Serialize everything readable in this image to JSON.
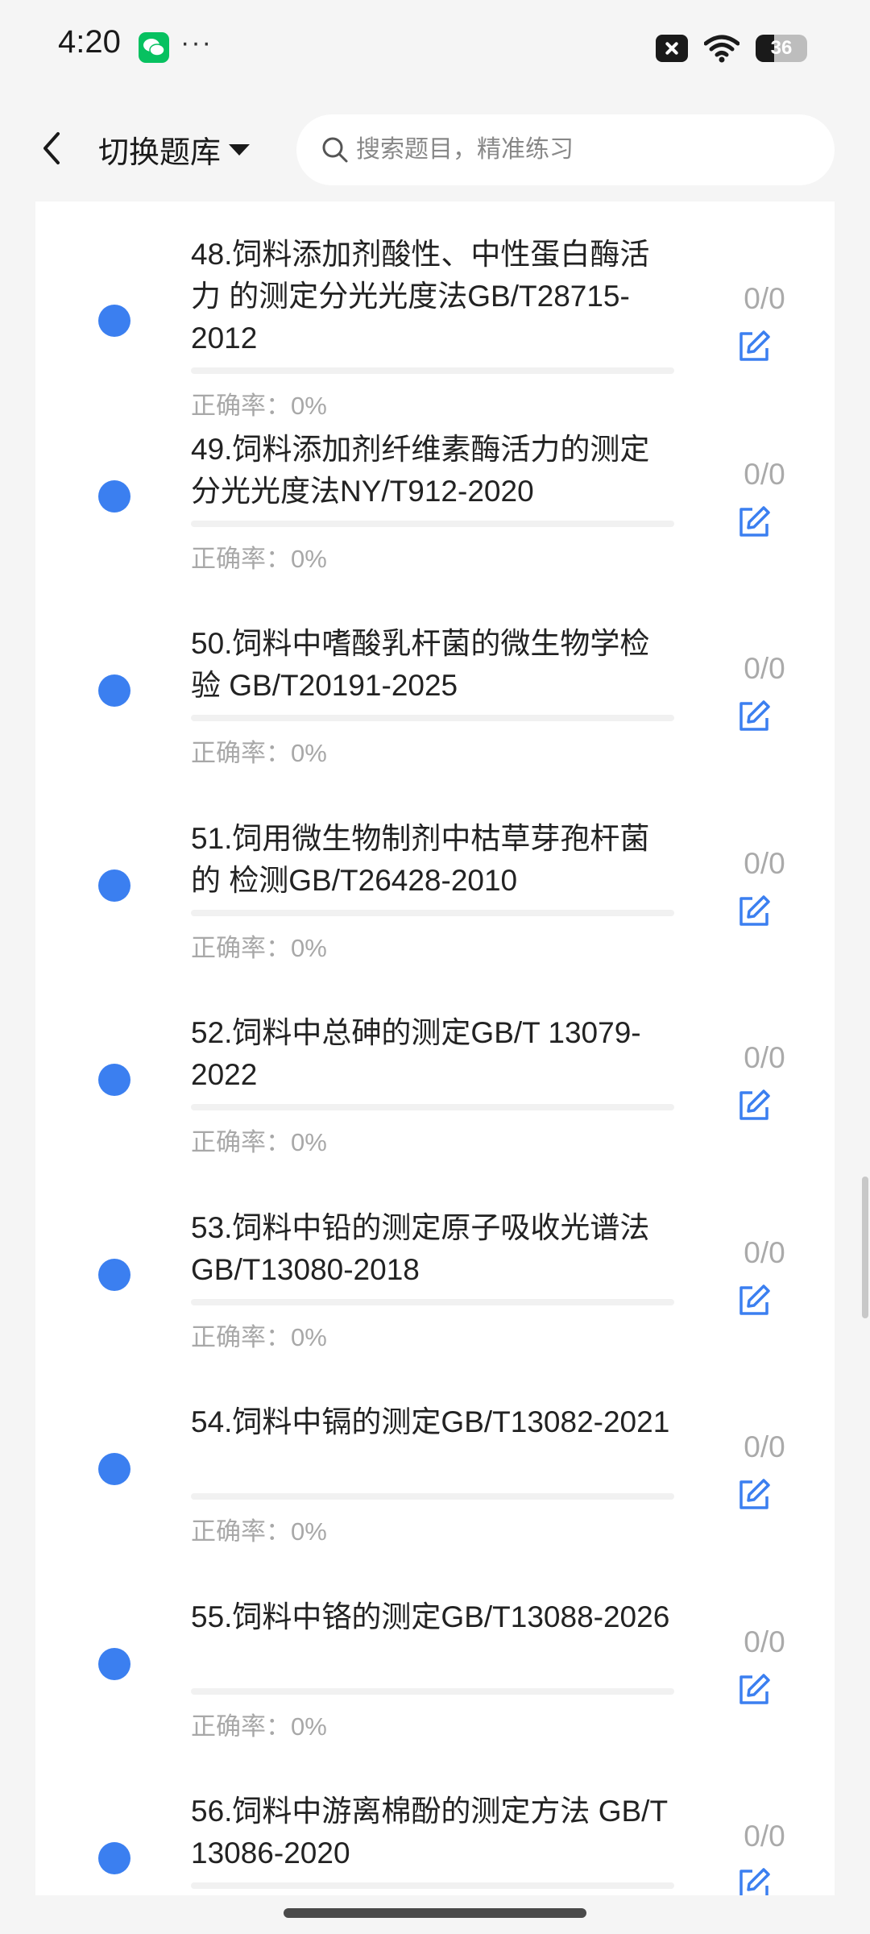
{
  "status_bar": {
    "time": "4:20",
    "dots": "···",
    "battery": "36",
    "icons": [
      "wechat-icon",
      "close-notification-icon",
      "wifi-icon",
      "battery-icon"
    ]
  },
  "header": {
    "title": "切换题库",
    "search_placeholder": "搜索题目，精准练习",
    "icons": [
      "back-icon",
      "caret-down-icon",
      "search-icon"
    ]
  },
  "accent_color": "#3b7ff0",
  "items": [
    {
      "title": "48.饲料添加剂酸性、中性蛋白酶活力 的测定分光光度法GB/T28715-2012",
      "accuracy": "正确率：0%",
      "score": "0/0",
      "progress": 0
    },
    {
      "title": "49.饲料添加剂纤维素酶活力的测定 分光光度法NY/T912-2020",
      "accuracy": "正确率：0%",
      "score": "0/0",
      "progress": 0
    },
    {
      "title": "50.饲料中嗜酸乳杆菌的微生物学检验 GB/T20191-2025",
      "accuracy": "正确率：0%",
      "score": "0/0",
      "progress": 0
    },
    {
      "title": "51.饲用微生物制剂中枯草芽孢杆菌的 检测GB/T26428-2010",
      "accuracy": "正确率：0%",
      "score": "0/0",
      "progress": 0
    },
    {
      "title": "52.饲料中总砷的测定GB/T 13079-2022",
      "accuracy": "正确率：0%",
      "score": "0/0",
      "progress": 0
    },
    {
      "title": "53.饲料中铅的测定原子吸收光谱法 GB/T13080-2018",
      "accuracy": "正确率：0%",
      "score": "0/0",
      "progress": 0
    },
    {
      "title": "54.饲料中镉的测定GB/T13082-2021",
      "accuracy": "正确率：0%",
      "score": "0/0",
      "progress": 0
    },
    {
      "title": "55.饲料中铬的测定GB/T13088-2026",
      "accuracy": "正确率：0%",
      "score": "0/0",
      "progress": 0
    },
    {
      "title": "56.饲料中游离棉酚的测定方法 GB/T 13086-2020",
      "accuracy": "",
      "score": "0/0",
      "progress": 0
    }
  ]
}
